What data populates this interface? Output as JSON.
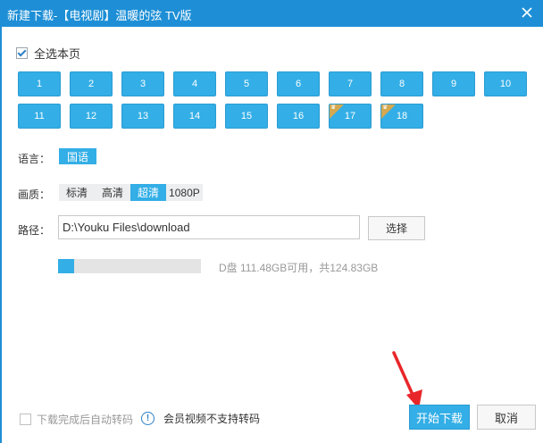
{
  "window": {
    "title": "新建下载-【电视剧】温暖的弦 TV版"
  },
  "select_all": {
    "label": "全选本页",
    "checked": true
  },
  "episodes": [
    {
      "num": "1"
    },
    {
      "num": "2"
    },
    {
      "num": "3"
    },
    {
      "num": "4"
    },
    {
      "num": "5"
    },
    {
      "num": "6"
    },
    {
      "num": "7"
    },
    {
      "num": "8"
    },
    {
      "num": "9"
    },
    {
      "num": "10"
    },
    {
      "num": "11"
    },
    {
      "num": "12"
    },
    {
      "num": "13"
    },
    {
      "num": "14"
    },
    {
      "num": "15"
    },
    {
      "num": "16"
    },
    {
      "num": "17",
      "vip": true
    },
    {
      "num": "18",
      "vip": true
    }
  ],
  "language": {
    "label": "语言：",
    "value": "国语"
  },
  "quality": {
    "label": "画质：",
    "options": [
      "标清",
      "高清",
      "超清",
      "1080P"
    ],
    "selected": "超清"
  },
  "path": {
    "label": "路径：",
    "value": "D:\\Youku Files\\download",
    "choose_label": "选择"
  },
  "disk": {
    "info": "D盘 111.48GB可用，共124.83GB",
    "used_fraction": 0.11
  },
  "auto_convert": {
    "label": "下载完成后自动转码",
    "checked": false
  },
  "notice": {
    "text": "会员视频不支持转码"
  },
  "buttons": {
    "start": "开始下载",
    "cancel": "取消"
  },
  "colors": {
    "accent": "#33aee6",
    "titlebar": "#1e8fd6",
    "vip": "#d4a84f",
    "annotation_arrow": "#e8262a"
  }
}
